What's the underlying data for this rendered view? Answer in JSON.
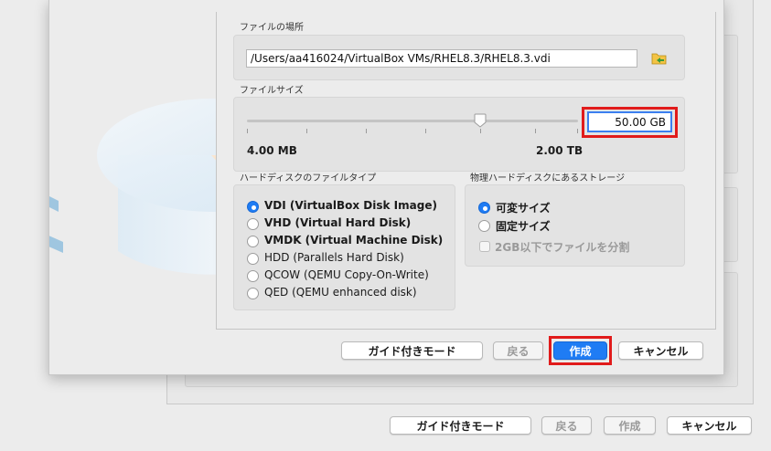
{
  "colors": {
    "accent": "#1f7cf4",
    "highlight": "#e11b1b"
  },
  "background_dialog": {
    "buttons": {
      "guided_mode": "ガイド付きモード",
      "back": "戻る",
      "create": "作成",
      "cancel": "キャンセル"
    }
  },
  "file_location": {
    "label": "ファイルの場所",
    "path": "/Users/aa416024/VirtualBox VMs/RHEL8.3/RHEL8.3.vdi",
    "browse_icon": "folder-icon"
  },
  "file_size": {
    "label": "ファイルサイズ",
    "value": "50.00 GB",
    "min_label": "4.00 MB",
    "max_label": "2.00 TB",
    "slider_position": 0.71
  },
  "file_type": {
    "label": "ハードディスクのファイルタイプ",
    "options": [
      {
        "label": "VDI (VirtualBox Disk Image)",
        "selected": true
      },
      {
        "label": "VHD (Virtual Hard Disk)",
        "selected": false
      },
      {
        "label": "VMDK (Virtual Machine Disk)",
        "selected": false
      },
      {
        "label": "HDD (Parallels Hard Disk)",
        "selected": false
      },
      {
        "label": "QCOW (QEMU Copy-On-Write)",
        "selected": false
      },
      {
        "label": "QED (QEMU enhanced disk)",
        "selected": false
      }
    ]
  },
  "storage": {
    "label": "物理ハードディスクにあるストレージ",
    "options": [
      {
        "label": "可変サイズ",
        "selected": true
      },
      {
        "label": "固定サイズ",
        "selected": false
      }
    ],
    "split_checkbox": {
      "label": "2GB以下でファイルを分割",
      "checked": false,
      "enabled": false
    }
  },
  "buttons": {
    "guided_mode": "ガイド付きモード",
    "back": "戻る",
    "create": "作成",
    "cancel": "キャンセル"
  }
}
